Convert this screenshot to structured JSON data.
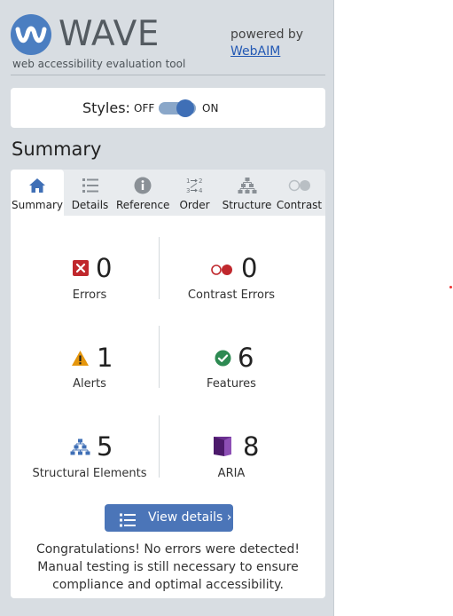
{
  "header": {
    "title": "WAVE",
    "subtitle": "web accessibility evaluation tool",
    "powered_by": "powered by",
    "webaim_link": "WebAIM"
  },
  "styles_toggle": {
    "label": "Styles:",
    "off_label": "OFF",
    "on_label": "ON",
    "state": "on"
  },
  "summary_heading": "Summary",
  "tabs": [
    {
      "label": "Summary",
      "icon": "home-icon",
      "active": true
    },
    {
      "label": "Details",
      "icon": "list-icon",
      "active": false
    },
    {
      "label": "Reference",
      "icon": "info-icon",
      "active": false
    },
    {
      "label": "Order",
      "icon": "order-icon",
      "active": false
    },
    {
      "label": "Structure",
      "icon": "structure-icon",
      "active": false
    },
    {
      "label": "Contrast",
      "icon": "contrast-icon",
      "active": false
    }
  ],
  "stats": {
    "errors": {
      "count": "0",
      "label": "Errors",
      "icon": "error-icon"
    },
    "contrast_errors": {
      "count": "0",
      "label": "Contrast Errors",
      "icon": "contrast-error-icon"
    },
    "alerts": {
      "count": "1",
      "label": "Alerts",
      "icon": "alert-icon"
    },
    "features": {
      "count": "6",
      "label": "Features",
      "icon": "feature-check-icon"
    },
    "structural": {
      "count": "5",
      "label": "Structural Elements",
      "icon": "structure-icon"
    },
    "aria": {
      "count": "8",
      "label": "ARIA",
      "icon": "aria-icon"
    }
  },
  "view_details_button": "View details ›",
  "congrats_message": "Congratulations! No errors were detected! Manual testing is still necessary to ensure compliance and optimal accessibility.",
  "colors": {
    "brand_blue": "#4b7ec1",
    "sidebar_bg": "#d8dde2",
    "error_red": "#c0282d",
    "alert_orange": "#e5960c",
    "feature_green": "#2d8a52",
    "aria_purple": "#6a2f8f",
    "structure_blue": "#3f6fb6",
    "button_blue": "#4b75b8"
  }
}
